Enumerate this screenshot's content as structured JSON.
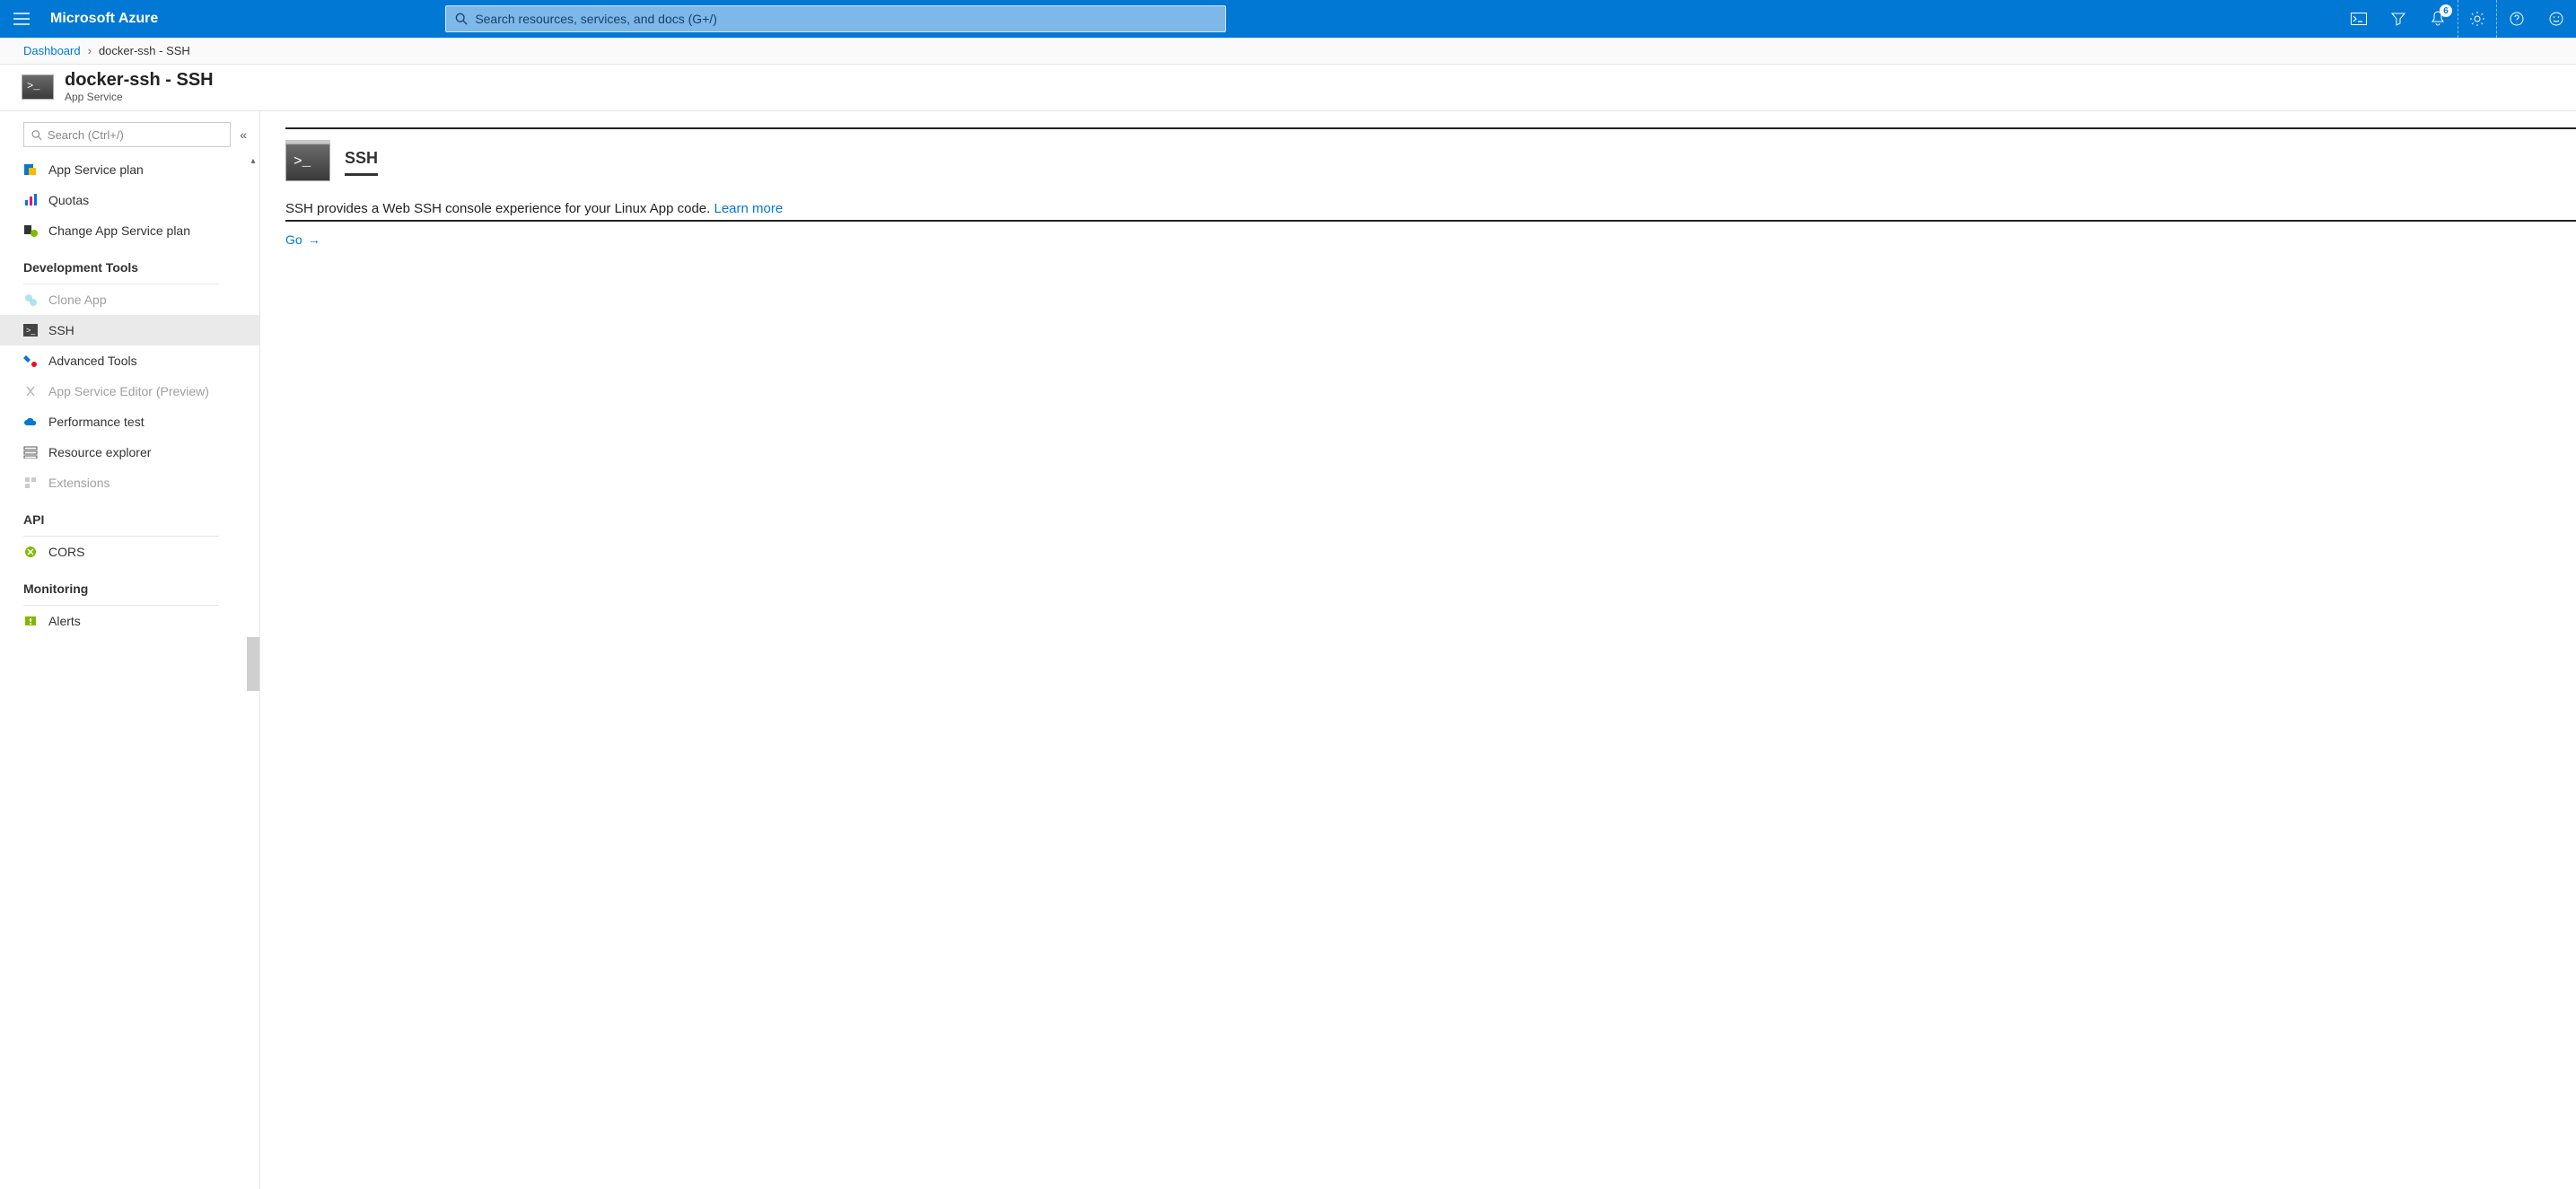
{
  "topbar": {
    "brand": "Microsoft Azure",
    "search_placeholder": "Search resources, services, and docs (G+/)",
    "notification_count": "6"
  },
  "breadcrumb": {
    "root": "Dashboard",
    "current": "docker-ssh - SSH"
  },
  "resource": {
    "title": "docker-ssh - SSH",
    "type": "App Service"
  },
  "sidebar": {
    "filter_placeholder": "Search (Ctrl+/)",
    "items": [
      {
        "label": "App Service plan",
        "group": null,
        "active": false,
        "disabled": false
      },
      {
        "label": "Quotas",
        "group": null,
        "active": false,
        "disabled": false
      },
      {
        "label": "Change App Service plan",
        "group": null,
        "active": false,
        "disabled": false
      },
      {
        "label": "Development Tools",
        "group": "header"
      },
      {
        "label": "Clone App",
        "group": null,
        "active": false,
        "disabled": true
      },
      {
        "label": "SSH",
        "group": null,
        "active": true,
        "disabled": false
      },
      {
        "label": "Advanced Tools",
        "group": null,
        "active": false,
        "disabled": false
      },
      {
        "label": "App Service Editor (Preview)",
        "group": null,
        "active": false,
        "disabled": true
      },
      {
        "label": "Performance test",
        "group": null,
        "active": false,
        "disabled": false
      },
      {
        "label": "Resource explorer",
        "group": null,
        "active": false,
        "disabled": false
      },
      {
        "label": "Extensions",
        "group": null,
        "active": false,
        "disabled": true
      },
      {
        "label": "API",
        "group": "header"
      },
      {
        "label": "CORS",
        "group": null,
        "active": false,
        "disabled": false
      },
      {
        "label": "Monitoring",
        "group": "header"
      },
      {
        "label": "Alerts",
        "group": null,
        "active": false,
        "disabled": false
      }
    ]
  },
  "content": {
    "heading": "SSH",
    "description": "SSH provides a Web SSH console experience for your Linux App code.",
    "learn_more": "Learn more",
    "go_label": "Go"
  }
}
